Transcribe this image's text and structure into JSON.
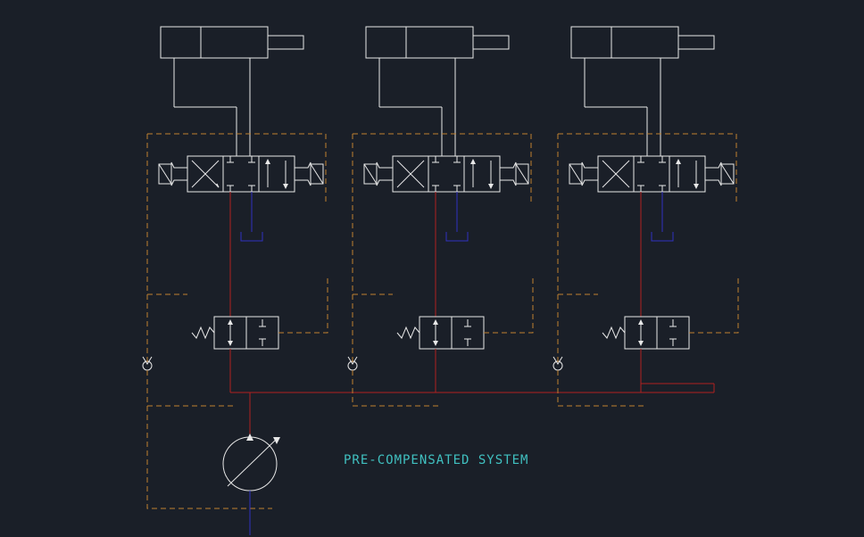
{
  "diagram": {
    "title": "PRE-COMPENSATED SYSTEM",
    "components": {
      "cylinders": [
        {
          "id": "cyl-1",
          "type": "double-acting-cylinder"
        },
        {
          "id": "cyl-2",
          "type": "double-acting-cylinder"
        },
        {
          "id": "cyl-3",
          "type": "double-acting-cylinder"
        }
      ],
      "directional_valves": [
        {
          "id": "dcv-1",
          "type": "4-3-directional-valve",
          "positions": 3,
          "actuation": "solenoid-spring"
        },
        {
          "id": "dcv-2",
          "type": "4-3-directional-valve",
          "positions": 3,
          "actuation": "solenoid-spring"
        },
        {
          "id": "dcv-3",
          "type": "4-3-directional-valve",
          "positions": 3,
          "actuation": "solenoid-spring"
        }
      ],
      "compensator_valves": [
        {
          "id": "comp-1",
          "type": "2-2-compensator",
          "spring": true
        },
        {
          "id": "comp-2",
          "type": "2-2-compensator",
          "spring": true
        },
        {
          "id": "comp-3",
          "type": "2-2-compensator",
          "spring": true
        }
      ],
      "check_valves": [
        {
          "id": "ck-1",
          "type": "check-valve"
        },
        {
          "id": "ck-2",
          "type": "check-valve"
        },
        {
          "id": "ck-3",
          "type": "check-valve"
        }
      ],
      "tanks": [
        {
          "id": "tank-1"
        },
        {
          "id": "tank-2"
        },
        {
          "id": "tank-3"
        }
      ],
      "pump": {
        "id": "pump-1",
        "type": "variable-displacement-pump"
      }
    },
    "line_colors": {
      "supply": "red",
      "return": "blue",
      "pilot": "orange-dashed",
      "symbol": "white"
    }
  }
}
